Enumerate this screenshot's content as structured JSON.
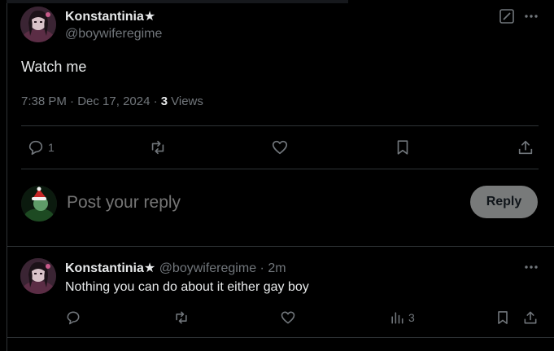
{
  "main_post": {
    "author_name": "Konstantinia",
    "author_badge": "★",
    "author_handle": "@boywiferegime",
    "text": "Watch me",
    "time": "7:38 PM",
    "date_sep": "·",
    "date": "Dec 17, 2024",
    "views_sep": "·",
    "views_count": "3",
    "views_label": "Views",
    "actions": {
      "reply_count": "1",
      "icons": [
        "reply-icon",
        "repost-icon",
        "like-icon",
        "bookmark-icon",
        "share-icon"
      ]
    },
    "header_icons": [
      "grok-icon",
      "more-icon"
    ]
  },
  "composer": {
    "placeholder": "Post your reply",
    "button_label": "Reply"
  },
  "reply_post": {
    "author_name": "Konstantinia",
    "author_badge": "★",
    "author_handle": "@boywiferegime",
    "sep": "·",
    "time": "2m",
    "text": "Nothing you can do about it either gay boy",
    "views_count": "3",
    "icons": [
      "reply-icon",
      "repost-icon",
      "like-icon",
      "views-icon",
      "bookmark-icon",
      "share-icon"
    ]
  },
  "colors": {
    "background": "#000000",
    "text": "#e7e9ea",
    "muted": "#71767b",
    "divider": "#2f3336",
    "reply_button": "#787a7a"
  }
}
